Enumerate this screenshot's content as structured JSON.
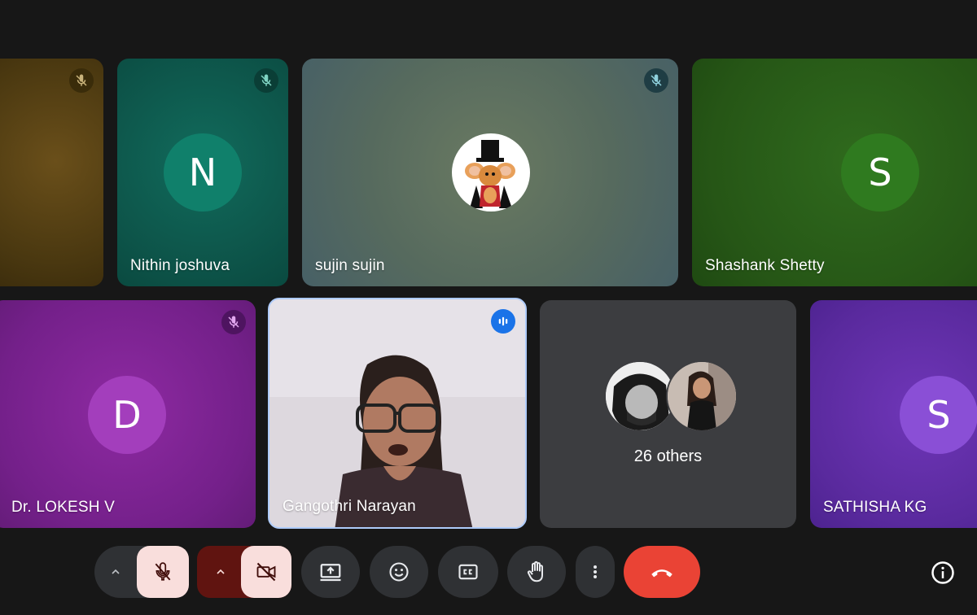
{
  "participants": [
    {
      "name": "",
      "initial": "",
      "muted": true
    },
    {
      "name": "Nithin joshuva",
      "initial": "N",
      "muted": true
    },
    {
      "name": "sujin sujin",
      "initial": "",
      "muted": true
    },
    {
      "name": "Shashank Shetty",
      "initial": "S",
      "muted": false
    },
    {
      "name": "Dr. LOKESH V",
      "initial": "D",
      "muted": true
    },
    {
      "name": "Gangothri Narayan",
      "initial": "",
      "speaking": true
    },
    {
      "name": "SATHISHA KG",
      "initial": "S",
      "muted": false
    }
  ],
  "others": {
    "label": "26 others"
  },
  "colors": {
    "background": "#171717",
    "end_call": "#ea4335",
    "mic_off_bg": "#f9dedc",
    "camera_off_bg": "#f9dedc",
    "camera_caret_bg": "#601410",
    "speaking_border": "#aecbfa"
  },
  "toolbar": {
    "icons": [
      "chevron-up-icon",
      "mic-off-icon",
      "chevron-up-icon",
      "camera-off-icon",
      "present-screen-icon",
      "emoji-icon",
      "captions-icon",
      "raise-hand-icon",
      "more-options-icon",
      "end-call-icon",
      "info-icon"
    ]
  }
}
